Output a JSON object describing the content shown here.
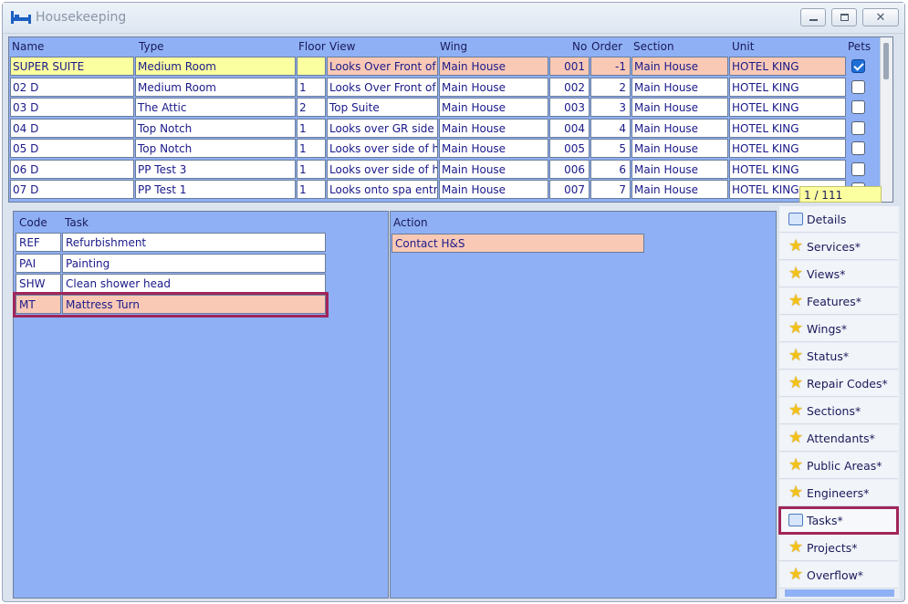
{
  "window": {
    "title": "Housekeeping"
  },
  "rooms": {
    "columns": [
      "Name",
      "Type",
      "Floor",
      "View",
      "Wing",
      "No",
      "Order",
      "Section",
      "Unit",
      "Pets"
    ],
    "rows": [
      {
        "name": "SUPER SUITE",
        "type": "Medium Room",
        "floor": "",
        "view": "Looks Over Front of",
        "wing": "Main House",
        "no": "001",
        "order": "-1",
        "section": "Main House",
        "unit": "HOTEL KING",
        "pets": true
      },
      {
        "name": "02 D",
        "type": "Medium Room",
        "floor": "1",
        "view": "Looks Over Front of",
        "wing": "Main House",
        "no": "002",
        "order": "2",
        "section": "Main House",
        "unit": "HOTEL KING",
        "pets": false
      },
      {
        "name": "03 D",
        "type": "The Attic",
        "floor": "2",
        "view": "Top Suite",
        "wing": "Main House",
        "no": "003",
        "order": "3",
        "section": "Main House",
        "unit": "HOTEL KING",
        "pets": false
      },
      {
        "name": "04 D",
        "type": "Top Notch",
        "floor": "1",
        "view": "Looks over GR side",
        "wing": "Main House",
        "no": "004",
        "order": "4",
        "section": "Main House",
        "unit": "HOTEL KING",
        "pets": false
      },
      {
        "name": "05 D",
        "type": "Top Notch",
        "floor": "1",
        "view": "Looks over side of h",
        "wing": "Main House",
        "no": "005",
        "order": "5",
        "section": "Main House",
        "unit": "HOTEL KING",
        "pets": false
      },
      {
        "name": "06 D",
        "type": "PP Test 3",
        "floor": "1",
        "view": "Looks over side of h",
        "wing": "Main House",
        "no": "006",
        "order": "6",
        "section": "Main House",
        "unit": "HOTEL KING",
        "pets": false
      },
      {
        "name": "07 D",
        "type": "PP Test 1",
        "floor": "1",
        "view": "Looks onto spa entr",
        "wing": "Main House",
        "no": "007",
        "order": "7",
        "section": "Main House",
        "unit": "HOTEL KING",
        "pets": false
      }
    ],
    "counter": "1 / 111"
  },
  "tasks": {
    "columns": [
      "Code",
      "Task"
    ],
    "rows": [
      {
        "code": "REF",
        "task": "Refurbishment"
      },
      {
        "code": "PAI",
        "task": "Painting"
      },
      {
        "code": "SHW",
        "task": "Clean shower head"
      },
      {
        "code": "MT",
        "task": "Mattress Turn"
      }
    ]
  },
  "actions": {
    "column": "Action",
    "rows": [
      "Contact H&S"
    ]
  },
  "nav": {
    "items": [
      {
        "label": "Details",
        "icon": "document-icon"
      },
      {
        "label": "Services*",
        "icon": "star-icon"
      },
      {
        "label": "Views*",
        "icon": "star-icon"
      },
      {
        "label": "Features*",
        "icon": "star-icon"
      },
      {
        "label": "Wings*",
        "icon": "star-icon"
      },
      {
        "label": "Status*",
        "icon": "star-icon"
      },
      {
        "label": "Repair Codes*",
        "icon": "star-icon"
      },
      {
        "label": "Sections*",
        "icon": "star-icon"
      },
      {
        "label": "Attendants*",
        "icon": "star-icon"
      },
      {
        "label": "Public Areas*",
        "icon": "star-icon"
      },
      {
        "label": "Engineers*",
        "icon": "star-icon"
      },
      {
        "label": "Tasks*",
        "icon": "document-icon"
      },
      {
        "label": "Projects*",
        "icon": "star-icon"
      },
      {
        "label": "Overflow*",
        "icon": "star-icon"
      }
    ],
    "selected": "Tasks*"
  },
  "colors": {
    "panel": "#8fb0f5",
    "selected_row": "#f9c9b6",
    "highlight_outline": "#a0265a",
    "counter_bg": "#fbff9f"
  }
}
